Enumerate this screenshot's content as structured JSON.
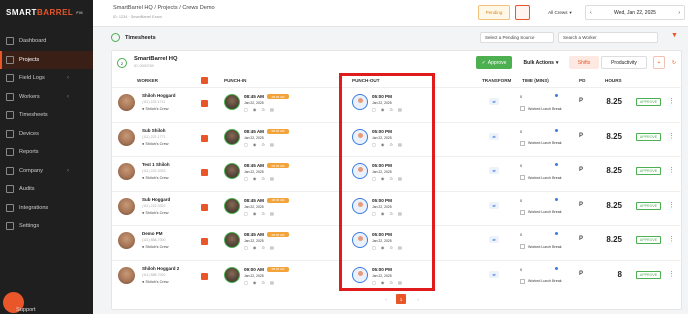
{
  "sidebar": {
    "logo_a": "SMART",
    "logo_b": "BARREL",
    "logo_badge": "FM",
    "items": [
      {
        "label": "Dashboard",
        "icon": "dashboard-icon"
      },
      {
        "label": "Projects",
        "icon": "folder-icon"
      },
      {
        "label": "Field Logs",
        "icon": "clipboard-icon"
      },
      {
        "label": "Workers",
        "icon": "users-icon"
      },
      {
        "label": "Timesheets",
        "icon": "clock-icon"
      },
      {
        "label": "Devices",
        "icon": "device-icon"
      },
      {
        "label": "Reports",
        "icon": "chart-icon"
      },
      {
        "label": "Company",
        "icon": "building-icon"
      },
      {
        "label": "Audits",
        "icon": "audit-icon"
      },
      {
        "label": "Integrations",
        "icon": "plug-icon"
      },
      {
        "label": "Settings",
        "icon": "gear-icon"
      }
    ],
    "support": "Support"
  },
  "header": {
    "breadcrumb": "SmartBarrel HQ  /  Projects  /  Crews Demo",
    "sub": "ID: 1234  ·  SmartBarrel Exam",
    "pending": "Pending",
    "crews": "All Crews",
    "date": "Wed, Jan 22, 2025"
  },
  "toolbar": {
    "title": "Timesheets",
    "source": "Select a Pending Source",
    "worker": "Search a Worker"
  },
  "group": {
    "name": "SmartBarrel HQ",
    "sub": "ID: 0000789",
    "approve": "Approve",
    "bulk": "Bulk Actions",
    "shifts": "Shifts",
    "productivity": "Productivity",
    "add": "+"
  },
  "columns": {
    "worker": "WORKER",
    "punch_in": "PUNCH-IN",
    "punch_out": "PUNCH-OUT",
    "transform": "TRANSFORM",
    "time": "TIME (MINS)",
    "pd": "PD",
    "hours": "HOURS"
  },
  "rows": [
    {
      "name": "Shiloh Hoggard",
      "phone": "(111) 222-1711",
      "crew": "Shiloh's Crew",
      "in_time": "08:45 AM",
      "in_tag": "08:45 AM",
      "in_date": "Jan 22, 2025",
      "out_time": "05:00 PM",
      "out_date": "Jan 22, 2025",
      "time": "0",
      "lunch": "Worked Lunch Break",
      "pd": "P",
      "hours": "8.25",
      "status": "APPROVE"
    },
    {
      "name": "Sub Shiloh",
      "phone": "(111) 222-1771",
      "crew": "Shiloh's Crew",
      "in_time": "08:45 AM",
      "in_tag": "08:45 AM",
      "in_date": "Jan 22, 2025",
      "out_time": "05:00 PM",
      "out_date": "Jan 22, 2025",
      "time": "0",
      "lunch": "Worked Lunch Break",
      "pd": "P",
      "hours": "8.25",
      "status": "APPROVE"
    },
    {
      "name": "Test 1 Shiloh",
      "phone": "(111) 222-3333",
      "crew": "Shiloh's Crew",
      "in_time": "08:45 AM",
      "in_tag": "08:45 AM",
      "in_date": "Jan 22, 2025",
      "out_time": "05:00 PM",
      "out_date": "Jan 22, 2025",
      "time": "0",
      "lunch": "Worked Lunch Break",
      "pd": "P",
      "hours": "8.25",
      "status": "APPROVE"
    },
    {
      "name": "Sub Hoggard",
      "phone": "(111) 222-3322",
      "crew": "Shiloh's Crew",
      "in_time": "08:45 AM",
      "in_tag": "08:45 AM",
      "in_date": "Jan 22, 2025",
      "out_time": "05:00 PM",
      "out_date": "Jan 22, 2025",
      "time": "0",
      "lunch": "Worked Lunch Break",
      "pd": "P",
      "hours": "8.25",
      "status": "APPROVE"
    },
    {
      "name": "Demo PM",
      "phone": "(111) 888-7000",
      "crew": "Shiloh's Crew",
      "in_time": "08:45 AM",
      "in_tag": "08:45 AM",
      "in_date": "Jan 22, 2025",
      "out_time": "05:00 PM",
      "out_date": "Jan 22, 2025",
      "time": "0",
      "lunch": "Worked Lunch Break",
      "pd": "P",
      "hours": "8.25",
      "status": "APPROVE"
    },
    {
      "name": "Shiloh Hoggard 2",
      "phone": "(111) 888-7002",
      "crew": "Shiloh's Crew",
      "in_time": "09:00 AM",
      "in_tag": "08:45 AM",
      "in_date": "Jan 22, 2025",
      "out_time": "05:00 PM",
      "out_date": "Jan 22, 2025",
      "time": "0",
      "lunch": "Worked Lunch Break",
      "pd": "P",
      "hours": "8",
      "status": "APPROVE"
    }
  ],
  "pager": {
    "prev": "‹",
    "current": "1",
    "next": "›"
  },
  "colors": {
    "accent": "#e8562a",
    "green": "#4caf50",
    "highlight": "#e01b1b"
  }
}
